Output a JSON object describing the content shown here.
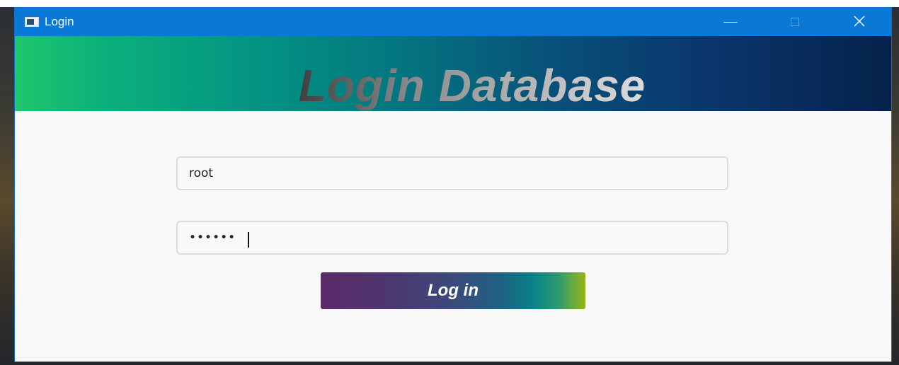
{
  "window": {
    "title": "Login",
    "title_bar_color": "#0a78d7"
  },
  "banner": {
    "title": "Login Database"
  },
  "form": {
    "username_value": "root",
    "password_masked": "••••••",
    "login_label": "Log in"
  },
  "icons": {
    "app": "window-app-icon",
    "minimize": "minimize-icon",
    "maximize": "maximize-icon",
    "close": "close-icon"
  }
}
